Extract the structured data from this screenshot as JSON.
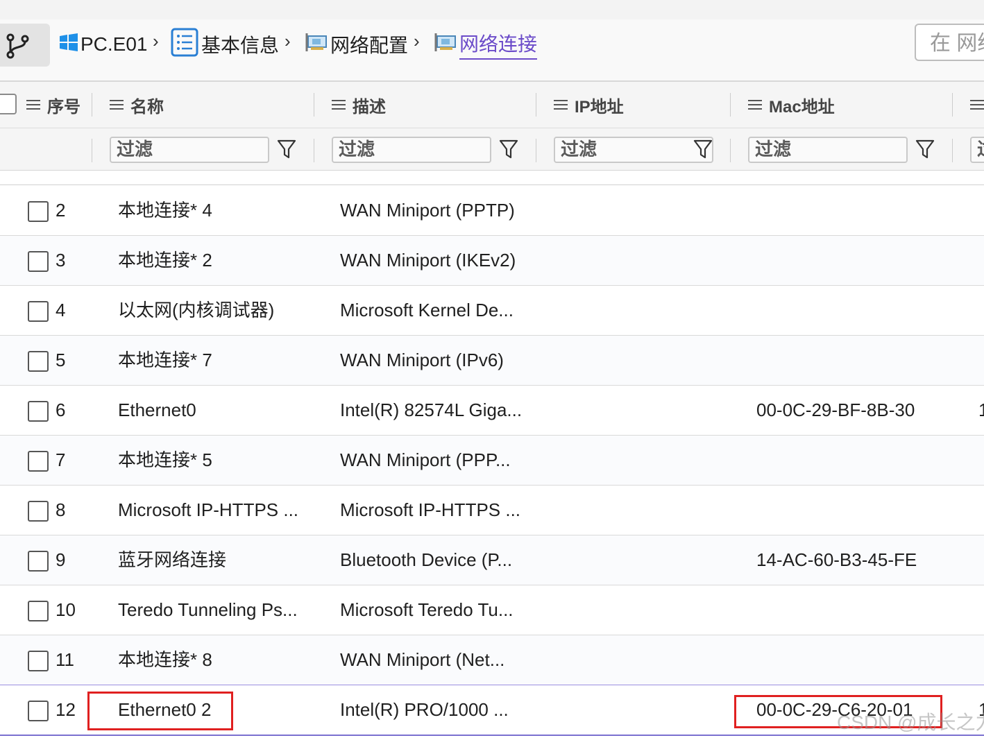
{
  "breadcrumb": {
    "items": [
      {
        "label": "PC.E01",
        "icon": "windows-logo-icon"
      },
      {
        "label": "基本信息",
        "icon": "list-icon"
      },
      {
        "label": "网络配置",
        "icon": "network-card-icon"
      },
      {
        "label": "网络连接",
        "icon": "network-card-icon",
        "active": true
      }
    ],
    "separator": "›"
  },
  "search": {
    "placeholder": "在 网络"
  },
  "table": {
    "columns": [
      {
        "label": "序号"
      },
      {
        "label": "名称"
      },
      {
        "label": "描述"
      },
      {
        "label": "IP地址"
      },
      {
        "label": "Mac地址"
      }
    ],
    "filter_label": "过滤",
    "rows": [
      {
        "no": "2",
        "name": "本地连接* 4",
        "desc": "WAN Miniport (PPTP)",
        "ip": "",
        "mac": "",
        "extra": ""
      },
      {
        "no": "3",
        "name": "本地连接* 2",
        "desc": "WAN Miniport (IKEv2)",
        "ip": "",
        "mac": "",
        "extra": ""
      },
      {
        "no": "4",
        "name": "以太网(内核调试器)",
        "desc": "Microsoft Kernel De...",
        "ip": "",
        "mac": "",
        "extra": ""
      },
      {
        "no": "5",
        "name": "本地连接* 7",
        "desc": "WAN Miniport (IPv6)",
        "ip": "",
        "mac": "",
        "extra": ""
      },
      {
        "no": "6",
        "name": "Ethernet0",
        "desc": "Intel(R) 82574L Giga...",
        "ip": "",
        "mac": "00-0C-29-BF-8B-30",
        "extra": "1"
      },
      {
        "no": "7",
        "name": "本地连接* 5",
        "desc": "WAN Miniport (PPP...",
        "ip": "",
        "mac": "",
        "extra": ""
      },
      {
        "no": "8",
        "name": "Microsoft IP-HTTPS ...",
        "desc": "Microsoft IP-HTTPS ...",
        "ip": "",
        "mac": "",
        "extra": ""
      },
      {
        "no": "9",
        "name": "蓝牙网络连接",
        "desc": "Bluetooth Device (P...",
        "ip": "",
        "mac": "14-AC-60-B3-45-FE",
        "extra": ""
      },
      {
        "no": "10",
        "name": "Teredo Tunneling Ps...",
        "desc": "Microsoft Teredo Tu...",
        "ip": "",
        "mac": "",
        "extra": ""
      },
      {
        "no": "11",
        "name": "本地连接* 8",
        "desc": "WAN Miniport (Net...",
        "ip": "",
        "mac": "",
        "extra": ""
      },
      {
        "no": "12",
        "name": "Ethernet0 2",
        "desc": "Intel(R) PRO/1000 ...",
        "ip": "",
        "mac": "00-0C-29-C6-20-01",
        "extra": "1"
      }
    ]
  },
  "watermark": "CSDN @成长之力",
  "colors": {
    "accent": "#6b4bc9",
    "highlight": "#e02020"
  }
}
